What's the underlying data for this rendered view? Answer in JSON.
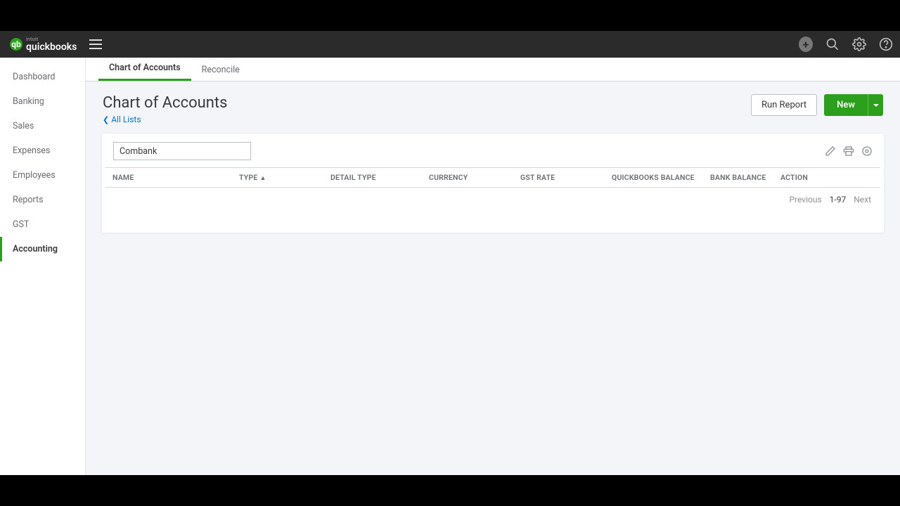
{
  "brand": {
    "top": "intuit",
    "main": "quickbooks"
  },
  "sidebar": {
    "items": [
      {
        "label": "Dashboard",
        "active": false
      },
      {
        "label": "Banking",
        "active": false
      },
      {
        "label": "Sales",
        "active": false
      },
      {
        "label": "Expenses",
        "active": false
      },
      {
        "label": "Employees",
        "active": false
      },
      {
        "label": "Reports",
        "active": false
      },
      {
        "label": "GST",
        "active": false
      },
      {
        "label": "Accounting",
        "active": true
      }
    ]
  },
  "subtabs": {
    "items": [
      {
        "label": "Chart of Accounts",
        "active": true
      },
      {
        "label": "Reconcile",
        "active": false
      }
    ]
  },
  "page": {
    "title": "Chart of Accounts",
    "back_label": "All Lists",
    "run_report": "Run Report",
    "new_label": "New"
  },
  "search": {
    "value": "Combank"
  },
  "table": {
    "headers": {
      "name": "NAME",
      "type": "TYPE",
      "detail": "DETAIL TYPE",
      "currency": "CURRENCY",
      "gst": "GST RATE",
      "qb_balance": "QUICKBOOKS BALANCE",
      "bank_balance": "BANK BALANCE",
      "action": "ACTION"
    }
  },
  "paging": {
    "prev": "Previous",
    "range": "1-97",
    "next": "Next"
  }
}
